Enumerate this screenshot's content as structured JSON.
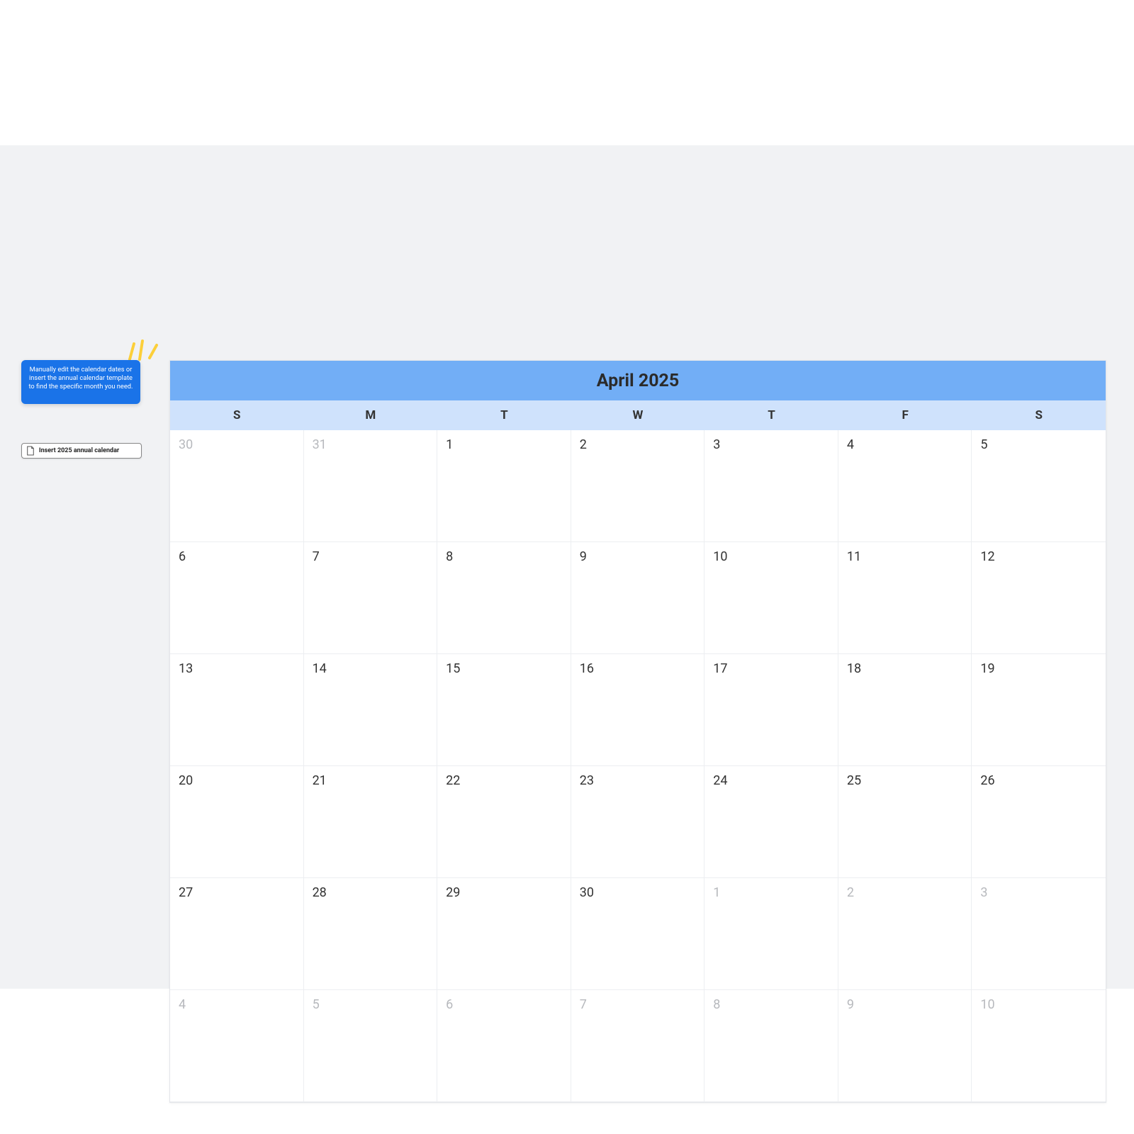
{
  "note": {
    "text": "Manually edit the calendar dates or insert the annual calendar template to find the specific month you need."
  },
  "insert_button": {
    "label": "Insert 2025 annual calendar"
  },
  "calendar": {
    "title": "April 2025",
    "days_of_week": [
      "S",
      "M",
      "T",
      "W",
      "T",
      "F",
      "S"
    ],
    "cells": [
      {
        "n": "30",
        "out": true
      },
      {
        "n": "31",
        "out": true
      },
      {
        "n": "1",
        "out": false
      },
      {
        "n": "2",
        "out": false
      },
      {
        "n": "3",
        "out": false
      },
      {
        "n": "4",
        "out": false
      },
      {
        "n": "5",
        "out": false
      },
      {
        "n": "6",
        "out": false
      },
      {
        "n": "7",
        "out": false
      },
      {
        "n": "8",
        "out": false
      },
      {
        "n": "9",
        "out": false
      },
      {
        "n": "10",
        "out": false
      },
      {
        "n": "11",
        "out": false
      },
      {
        "n": "12",
        "out": false
      },
      {
        "n": "13",
        "out": false
      },
      {
        "n": "14",
        "out": false
      },
      {
        "n": "15",
        "out": false
      },
      {
        "n": "16",
        "out": false
      },
      {
        "n": "17",
        "out": false
      },
      {
        "n": "18",
        "out": false
      },
      {
        "n": "19",
        "out": false
      },
      {
        "n": "20",
        "out": false
      },
      {
        "n": "21",
        "out": false
      },
      {
        "n": "22",
        "out": false
      },
      {
        "n": "23",
        "out": false
      },
      {
        "n": "24",
        "out": false
      },
      {
        "n": "25",
        "out": false
      },
      {
        "n": "26",
        "out": false
      },
      {
        "n": "27",
        "out": false
      },
      {
        "n": "28",
        "out": false
      },
      {
        "n": "29",
        "out": false
      },
      {
        "n": "30",
        "out": false
      },
      {
        "n": "1",
        "out": true
      },
      {
        "n": "2",
        "out": true
      },
      {
        "n": "3",
        "out": true
      },
      {
        "n": "4",
        "out": true
      },
      {
        "n": "5",
        "out": true
      },
      {
        "n": "6",
        "out": true
      },
      {
        "n": "7",
        "out": true
      },
      {
        "n": "8",
        "out": true
      },
      {
        "n": "9",
        "out": true
      },
      {
        "n": "10",
        "out": true
      }
    ]
  }
}
